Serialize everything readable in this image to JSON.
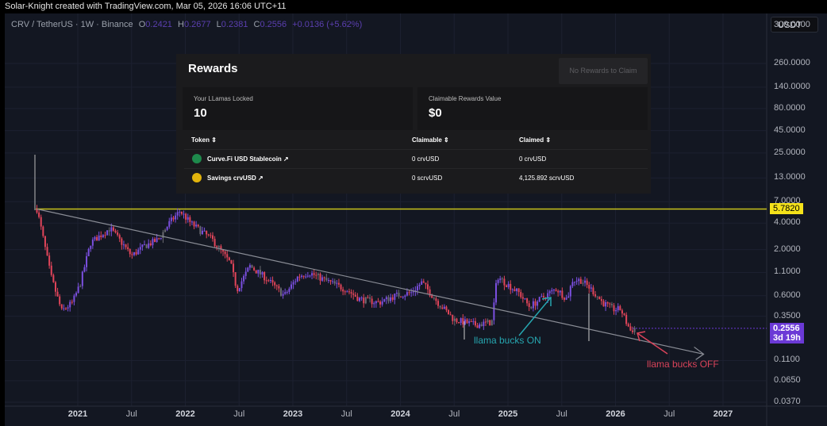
{
  "credit": "Solar-Knight created with TradingView.com, Mar 05, 2026 16:06 UTC+11",
  "legend": {
    "symbol": "CRV / TetherUS · 1W · Binance",
    "o_label": "O",
    "o": "0.2421",
    "h_label": "H",
    "h": "0.2677",
    "l_label": "L",
    "l": "0.2381",
    "c_label": "C",
    "c": "0.2556",
    "change": "+0.0136 (+5.62%)"
  },
  "currency_button": "USDT",
  "price_axis": [
    "300.0000",
    "260.0000",
    "140.0000",
    "80.0000",
    "45.0000",
    "25.0000",
    "13.0000",
    "7.0000",
    "4.0000",
    "2.0000",
    "1.1000",
    "0.6000",
    "0.3500",
    "0.1100",
    "0.0650",
    "0.0370"
  ],
  "price_axis_values": [
    300,
    260,
    140,
    80,
    45,
    25,
    13,
    7,
    4,
    2,
    1.1,
    0.6,
    0.35,
    0.11,
    0.065,
    0.037
  ],
  "time_axis": [
    {
      "label": "2021",
      "t": 2021,
      "year": true
    },
    {
      "label": "Jul",
      "t": 2021.5
    },
    {
      "label": "2022",
      "t": 2022,
      "year": true
    },
    {
      "label": "Jul",
      "t": 2022.5
    },
    {
      "label": "2023",
      "t": 2023,
      "year": true
    },
    {
      "label": "Jul",
      "t": 2023.5
    },
    {
      "label": "2024",
      "t": 2024,
      "year": true
    },
    {
      "label": "Jul",
      "t": 2024.5
    },
    {
      "label": "2025",
      "t": 2025,
      "year": true
    },
    {
      "label": "Jul",
      "t": 2025.5
    },
    {
      "label": "2026",
      "t": 2026,
      "year": true
    },
    {
      "label": "Jul",
      "t": 2026.5
    },
    {
      "label": "2027",
      "t": 2027,
      "year": true
    }
  ],
  "horizontal_line": {
    "price": 5.782,
    "label": "5.7820",
    "color": "#c9c21c"
  },
  "last_price": {
    "price": "0.2556",
    "countdown": "3d 19h",
    "color": "#6b39d6"
  },
  "trendline": {
    "start": [
      2020.62,
      5.782
    ],
    "end": [
      2026.82,
      0.13
    ]
  },
  "annotations": [
    {
      "text": "llama bucks ON",
      "color": "#26a6b0"
    },
    {
      "text": "llama bucks OFF",
      "color": "#d9435a"
    }
  ],
  "chart_data": {
    "type": "candlestick",
    "scale": "log",
    "key_closes": [
      [
        2020.62,
        5.8
      ],
      [
        2020.67,
        3.0
      ],
      [
        2020.75,
        1.0
      ],
      [
        2020.85,
        0.4
      ],
      [
        2020.95,
        0.5
      ],
      [
        2021.02,
        0.8
      ],
      [
        2021.12,
        2.4
      ],
      [
        2021.3,
        3.5
      ],
      [
        2021.42,
        2.3
      ],
      [
        2021.5,
        1.7
      ],
      [
        2021.62,
        2.2
      ],
      [
        2021.75,
        2.6
      ],
      [
        2021.85,
        4.0
      ],
      [
        2021.95,
        5.5
      ],
      [
        2022.05,
        4.0
      ],
      [
        2022.25,
        2.6
      ],
      [
        2022.42,
        1.4
      ],
      [
        2022.48,
        0.7
      ],
      [
        2022.6,
        1.3
      ],
      [
        2022.75,
        0.95
      ],
      [
        2022.92,
        0.6
      ],
      [
        2023.05,
        1.0
      ],
      [
        2023.15,
        1.1
      ],
      [
        2023.3,
        0.9
      ],
      [
        2023.5,
        0.7
      ],
      [
        2023.62,
        0.55
      ],
      [
        2023.8,
        0.5
      ],
      [
        2023.95,
        0.6
      ],
      [
        2024.1,
        0.65
      ],
      [
        2024.2,
        0.85
      ],
      [
        2024.35,
        0.5
      ],
      [
        2024.5,
        0.32
      ],
      [
        2024.7,
        0.28
      ],
      [
        2024.85,
        0.3
      ],
      [
        2024.9,
        1.0
      ],
      [
        2024.97,
        0.85
      ],
      [
        2025.1,
        0.65
      ],
      [
        2025.2,
        0.45
      ],
      [
        2025.35,
        0.6
      ],
      [
        2025.45,
        0.72
      ],
      [
        2025.55,
        0.55
      ],
      [
        2025.6,
        0.9
      ],
      [
        2025.68,
        0.9
      ],
      [
        2025.78,
        0.7
      ],
      [
        2025.88,
        0.5
      ],
      [
        2025.98,
        0.42
      ],
      [
        2026.05,
        0.42
      ],
      [
        2026.1,
        0.3
      ],
      [
        2026.14,
        0.24
      ],
      [
        2026.18,
        0.2556
      ]
    ]
  },
  "rewards": {
    "title": "Rewards",
    "claim_button": "No Rewards to Claim",
    "locked_label": "Your LLamas Locked",
    "locked_value": "10",
    "value_label": "Claimable Rewards Value",
    "value": "$0",
    "columns": [
      "Token ⇕",
      "Claimable ⇕",
      "Claimed ⇕"
    ],
    "rows": [
      {
        "token": "Curve.Fi USD Stablecoin ↗",
        "claimable": "0 crvUSD",
        "claimed": "0 crvUSD",
        "icon_color": "#1e8a4c"
      },
      {
        "token": "Savings crvUSD ↗",
        "claimable": "0 scrvUSD",
        "claimed": "4,125.892 scrvUSD",
        "icon_color": "#e2b40c"
      }
    ]
  }
}
